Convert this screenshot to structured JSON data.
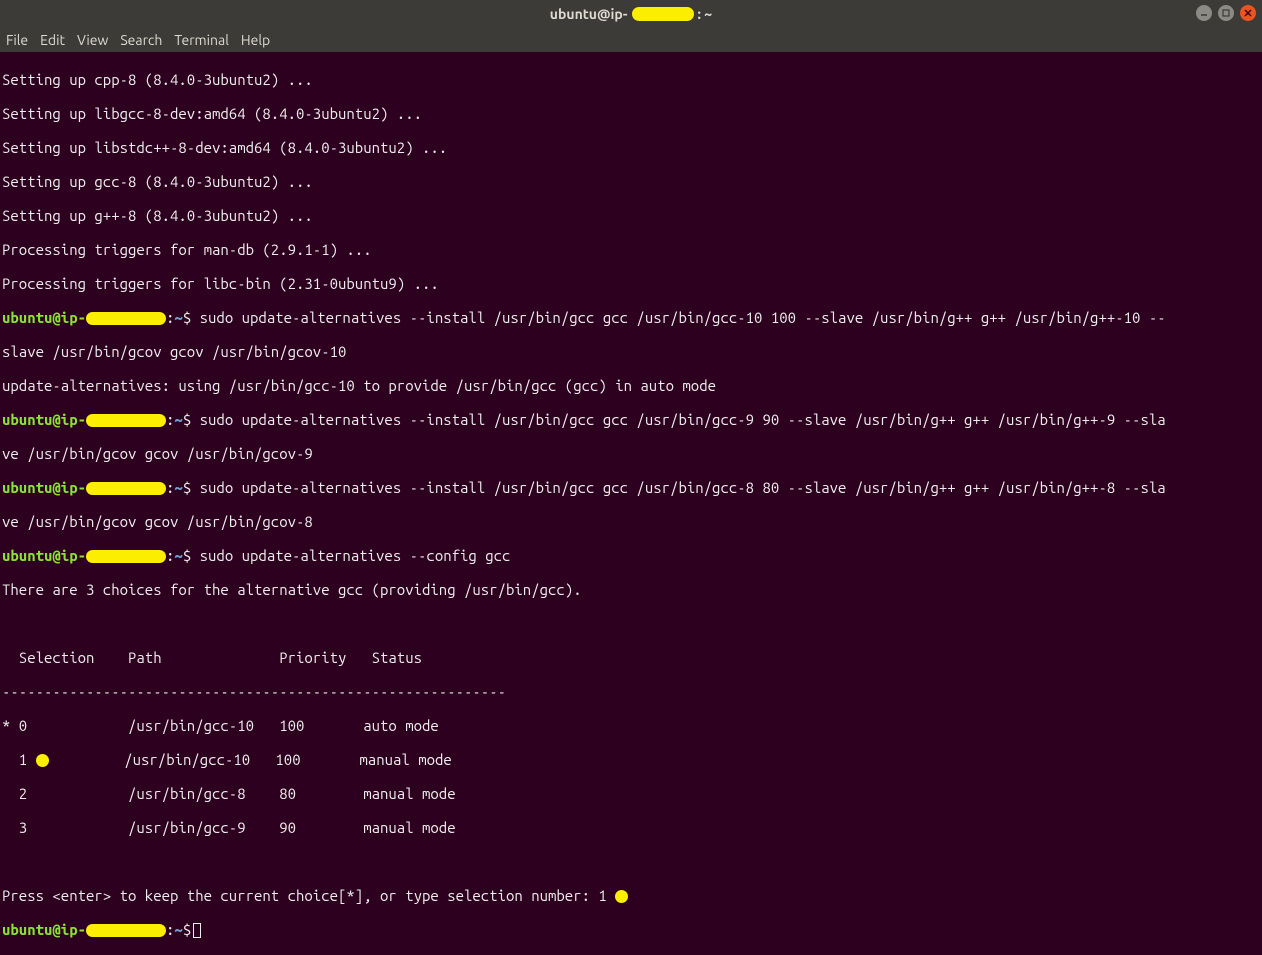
{
  "titlebar": {
    "prefix": "ubuntu@ip-",
    "suffix": ": ~"
  },
  "menubar": {
    "file": "File",
    "edit": "Edit",
    "view": "View",
    "search": "Search",
    "terminal": "Terminal",
    "help": "Help"
  },
  "prompt": {
    "user_prefix": "ubuntu@ip-",
    "colon": ":",
    "path": "~",
    "dollar": "$"
  },
  "output": {
    "l1": "Setting up cpp-8 (8.4.0-3ubuntu2) ...",
    "l2": "Setting up libgcc-8-dev:amd64 (8.4.0-3ubuntu2) ...",
    "l3": "Setting up libstdc++-8-dev:amd64 (8.4.0-3ubuntu2) ...",
    "l4": "Setting up gcc-8 (8.4.0-3ubuntu2) ...",
    "l5": "Setting up g++-8 (8.4.0-3ubuntu2) ...",
    "l6": "Processing triggers for man-db (2.9.1-1) ...",
    "l7": "Processing triggers for libc-bin (2.31-0ubuntu9) ...",
    "cmd1a": " sudo update-alternatives --install /usr/bin/gcc gcc /usr/bin/gcc-10 100 --slave /usr/bin/g++ g++ /usr/bin/g++-10 --",
    "cmd1b": "slave /usr/bin/gcov gcov /usr/bin/gcov-10",
    "l8": "update-alternatives: using /usr/bin/gcc-10 to provide /usr/bin/gcc (gcc) in auto mode",
    "cmd2a": " sudo update-alternatives --install /usr/bin/gcc gcc /usr/bin/gcc-9 90 --slave /usr/bin/g++ g++ /usr/bin/g++-9 --sla",
    "cmd2b": "ve /usr/bin/gcov gcov /usr/bin/gcov-9",
    "cmd3a": " sudo update-alternatives --install /usr/bin/gcc gcc /usr/bin/gcc-8 80 --slave /usr/bin/g++ g++ /usr/bin/g++-8 --sla",
    "cmd3b": "ve /usr/bin/gcov gcov /usr/bin/gcov-8",
    "cmd4": " sudo update-alternatives --config gcc",
    "l9": "There are 3 choices for the alternative gcc (providing /usr/bin/gcc).",
    "tblhead": "  Selection    Path              Priority   Status",
    "tblrule": "------------------------------------------------------------",
    "r0": "* 0            /usr/bin/gcc-10   100       auto mode",
    "r1a": "  1 ",
    "r1b": "         /usr/bin/gcc-10   100       manual mode",
    "r2": "  2            /usr/bin/gcc-8    80        manual mode",
    "r3": "  3            /usr/bin/gcc-9    90        manual mode",
    "press": "Press <enter> to keep the current choice[*], or type selection number: 1 "
  }
}
